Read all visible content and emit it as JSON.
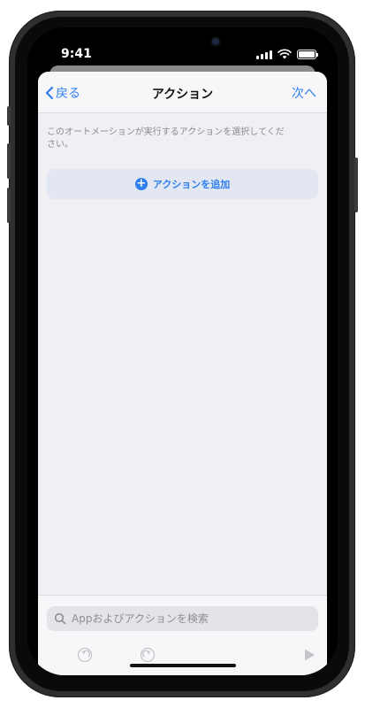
{
  "status_bar": {
    "time": "9:41"
  },
  "navbar": {
    "back_label": "戻る",
    "title": "アクション",
    "next_label": "次へ"
  },
  "content": {
    "description": "このオートメーションが実行するアクションを選択してください。",
    "add_action_label": "アクションを追加"
  },
  "toolbar": {
    "search_placeholder": "Appおよびアクションを検索",
    "icons": [
      "undo-icon",
      "redo-icon",
      "play-icon"
    ]
  },
  "colors": {
    "accent": "#2f7ff0",
    "sheet_bg": "#efeff4",
    "device": "#2e2f31"
  }
}
